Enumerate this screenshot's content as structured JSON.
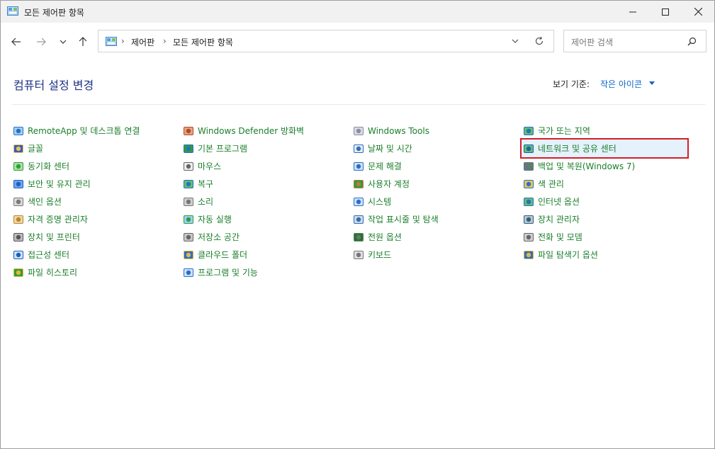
{
  "window": {
    "title": "모든 제어판 항목"
  },
  "nav": {
    "back": "back-arrow-icon",
    "forward": "forward-arrow-icon",
    "recent": "chevron-down-icon",
    "up": "up-arrow-icon"
  },
  "address": {
    "crumbs": [
      "제어판",
      "모든 제어판 항목"
    ]
  },
  "search": {
    "placeholder": "제어판 검색"
  },
  "header": {
    "title": "컴퓨터 설정 변경",
    "view_by_label": "보기 기준:",
    "view_by_value": "작은 아이콘"
  },
  "columns": [
    [
      {
        "label": "RemoteApp 및 데스크톱 연결",
        "icon": "remoteapp-icon"
      },
      {
        "label": "글꼴",
        "icon": "font-icon"
      },
      {
        "label": "동기화 센터",
        "icon": "sync-icon"
      },
      {
        "label": "보안 및 유지 관리",
        "icon": "flag-icon"
      },
      {
        "label": "색인 옵션",
        "icon": "index-icon"
      },
      {
        "label": "자격 증명 관리자",
        "icon": "credential-icon"
      },
      {
        "label": "장치 및 프린터",
        "icon": "printer-icon"
      },
      {
        "label": "접근성 센터",
        "icon": "accessibility-icon"
      },
      {
        "label": "파일 히스토리",
        "icon": "file-history-icon"
      }
    ],
    [
      {
        "label": "Windows Defender 방화벽",
        "icon": "firewall-icon"
      },
      {
        "label": "기본 프로그램",
        "icon": "default-programs-icon"
      },
      {
        "label": "마우스",
        "icon": "mouse-icon"
      },
      {
        "label": "복구",
        "icon": "recovery-icon"
      },
      {
        "label": "소리",
        "icon": "speaker-icon"
      },
      {
        "label": "자동 실행",
        "icon": "autoplay-icon"
      },
      {
        "label": "저장소 공간",
        "icon": "storage-icon"
      },
      {
        "label": "클라우드 폴더",
        "icon": "work-folders-icon"
      },
      {
        "label": "프로그램 및 기능",
        "icon": "programs-icon"
      }
    ],
    [
      {
        "label": "Windows Tools",
        "icon": "tools-icon"
      },
      {
        "label": "날짜 및 시간",
        "icon": "clock-icon"
      },
      {
        "label": "문제 해결",
        "icon": "troubleshoot-icon"
      },
      {
        "label": "사용자 계정",
        "icon": "users-icon"
      },
      {
        "label": "시스템",
        "icon": "system-icon"
      },
      {
        "label": "작업 표시줄 및 탐색",
        "icon": "taskbar-icon"
      },
      {
        "label": "전원 옵션",
        "icon": "power-icon"
      },
      {
        "label": "키보드",
        "icon": "keyboard-icon"
      }
    ],
    [
      {
        "label": "국가 또는 지역",
        "icon": "globe-icon"
      },
      {
        "label": "네트워크 및 공유 센터",
        "icon": "network-icon",
        "highlighted": true
      },
      {
        "label": "백업 및 복원(Windows 7)",
        "icon": "backup-icon"
      },
      {
        "label": "색 관리",
        "icon": "color-management-icon"
      },
      {
        "label": "인터넷 옵션",
        "icon": "internet-options-icon"
      },
      {
        "label": "장치 관리자",
        "icon": "device-manager-icon"
      },
      {
        "label": "전화 및 모뎀",
        "icon": "phone-modem-icon"
      },
      {
        "label": "파일 탐색기 옵션",
        "icon": "folder-options-icon"
      }
    ]
  ],
  "colors": {
    "link_green": "#1a7e2a",
    "heading_blue": "#1e3287",
    "accent_blue": "#0a64c8",
    "highlight_border": "#d21f2a"
  }
}
